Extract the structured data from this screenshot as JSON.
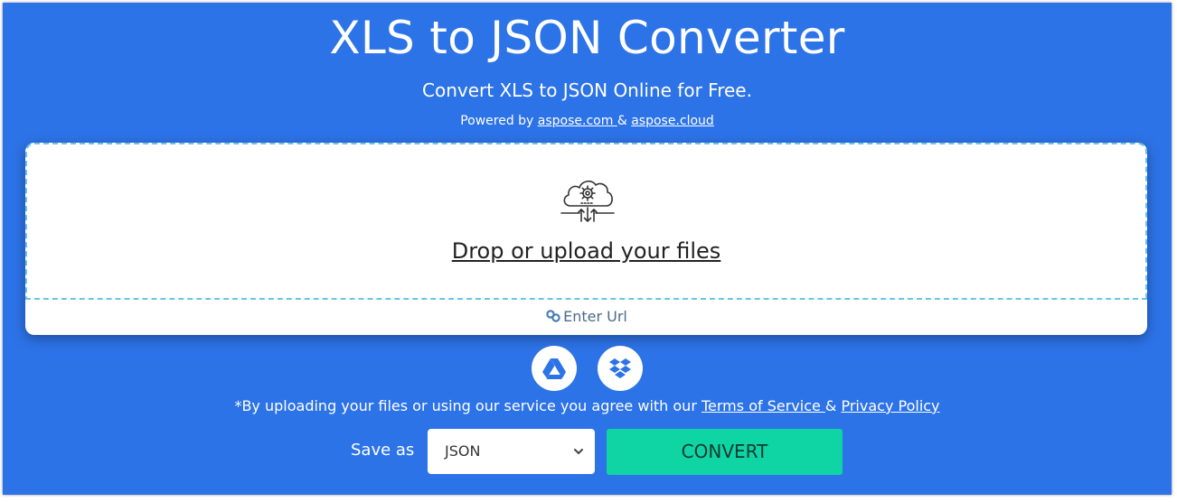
{
  "header": {
    "title": "XLS to JSON Converter",
    "subtitle": "Convert XLS to JSON Online for Free.",
    "powered_prefix": "Powered by ",
    "powered_link_1": "aspose.com ",
    "powered_amp": "& ",
    "powered_link_2": "aspose.cloud"
  },
  "upload": {
    "drop_text": "Drop or upload your files",
    "enter_url": "Enter Url",
    "icons": [
      "cloud-gear-upload-icon",
      "link-icon"
    ]
  },
  "cloud_sources": [
    {
      "name": "google-drive-icon"
    },
    {
      "name": "dropbox-icon"
    }
  ],
  "agreement": {
    "prefix": "*By uploading your files or using our service you agree with our ",
    "terms": "Terms of Service ",
    "amp": "& ",
    "privacy": "Privacy Policy"
  },
  "actions": {
    "save_as_label": "Save as",
    "format_selected": "JSON",
    "convert_label": "CONVERT"
  },
  "colors": {
    "background": "#2d73e8",
    "convert_button": "#0fd4a3",
    "dropzone_border": "#6cc3e8"
  }
}
